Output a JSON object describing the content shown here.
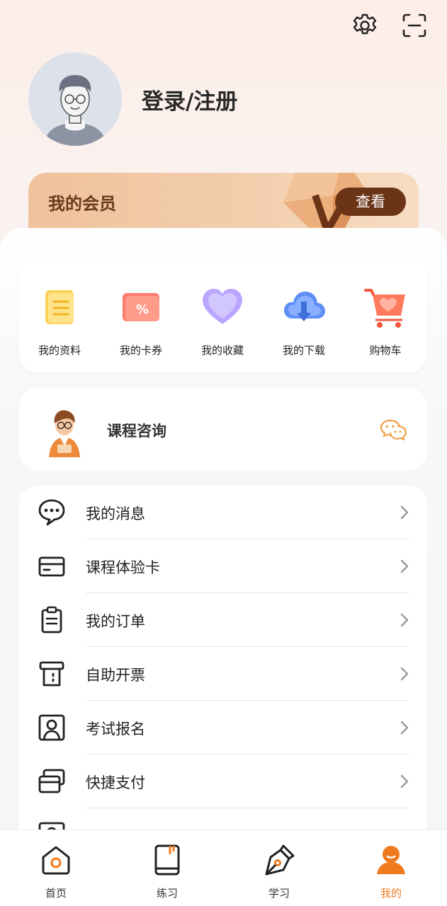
{
  "header": {
    "settings_icon": "gear-icon",
    "scan_icon": "scan-icon",
    "login_label": "登录/注册"
  },
  "vip": {
    "title": "我的会员",
    "button": "查看"
  },
  "quick_actions": [
    {
      "label": "我的资料",
      "icon": "book-icon"
    },
    {
      "label": "我的卡券",
      "icon": "coupon-icon"
    },
    {
      "label": "我的收藏",
      "icon": "heart-icon"
    },
    {
      "label": "我的下载",
      "icon": "cloud-download-icon"
    },
    {
      "label": "购物车",
      "icon": "cart-icon"
    }
  ],
  "consult": {
    "title": "课程咨询",
    "icon": "wechat-icon"
  },
  "menu": [
    {
      "label": "我的消息",
      "icon": "message-icon"
    },
    {
      "label": "课程体验卡",
      "icon": "card-icon"
    },
    {
      "label": "我的订单",
      "icon": "clipboard-icon"
    },
    {
      "label": "自助开票",
      "icon": "invoice-icon"
    },
    {
      "label": "考试报名",
      "icon": "id-badge-icon"
    },
    {
      "label": "快捷支付",
      "icon": "payment-card-icon"
    }
  ],
  "bottom_nav": [
    {
      "label": "首页",
      "icon": "home-icon",
      "active": false
    },
    {
      "label": "练习",
      "icon": "notebook-icon",
      "active": false
    },
    {
      "label": "学习",
      "icon": "pen-icon",
      "active": false
    },
    {
      "label": "我的",
      "icon": "user-icon",
      "active": true
    }
  ],
  "colors": {
    "accent": "#f07a1e",
    "vip_button": "#6b3417",
    "vip_text": "#6a3a1e"
  }
}
